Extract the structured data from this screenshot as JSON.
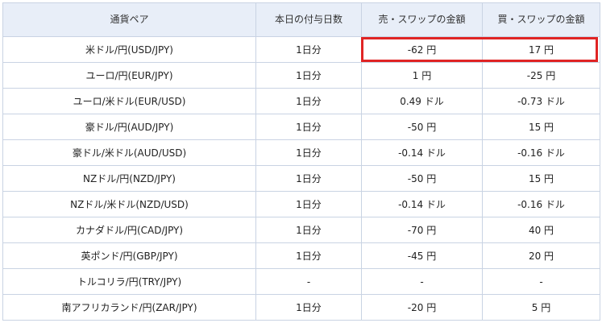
{
  "table": {
    "headers": [
      "通貨ペア",
      "本日の付与日数",
      "売・スワップの金額",
      "買・スワップの金額"
    ],
    "rows": [
      {
        "pair": "米ドル/円(USD/JPY)",
        "days": "1日分",
        "sell": "-62 円",
        "buy": "17 円"
      },
      {
        "pair": "ユーロ/円(EUR/JPY)",
        "days": "1日分",
        "sell": "1 円",
        "buy": "-25 円"
      },
      {
        "pair": "ユーロ/米ドル(EUR/USD)",
        "days": "1日分",
        "sell": "0.49 ドル",
        "buy": "-0.73 ドル"
      },
      {
        "pair": "豪ドル/円(AUD/JPY)",
        "days": "1日分",
        "sell": "-50 円",
        "buy": "15 円"
      },
      {
        "pair": "豪ドル/米ドル(AUD/USD)",
        "days": "1日分",
        "sell": "-0.14 ドル",
        "buy": "-0.16 ドル"
      },
      {
        "pair": "NZドル/円(NZD/JPY)",
        "days": "1日分",
        "sell": "-50 円",
        "buy": "15 円"
      },
      {
        "pair": "NZドル/米ドル(NZD/USD)",
        "days": "1日分",
        "sell": "-0.14 ドル",
        "buy": "-0.16 ドル"
      },
      {
        "pair": "カナダドル/円(CAD/JPY)",
        "days": "1日分",
        "sell": "-70 円",
        "buy": "40 円"
      },
      {
        "pair": "英ポンド/円(GBP/JPY)",
        "days": "1日分",
        "sell": "-45 円",
        "buy": "20 円"
      },
      {
        "pair": "トルコリラ/円(TRY/JPY)",
        "days": "-",
        "sell": "-",
        "buy": "-"
      },
      {
        "pair": "南アフリカランド/円(ZAR/JPY)",
        "days": "1日分",
        "sell": "-20 円",
        "buy": "5 円"
      }
    ]
  },
  "colors": {
    "header_bg": "#e8eef8",
    "border": "#c9d3e3",
    "sell_text": "#1a2f8f",
    "buy_text": "#c81e1e",
    "highlight": "#e02424"
  }
}
